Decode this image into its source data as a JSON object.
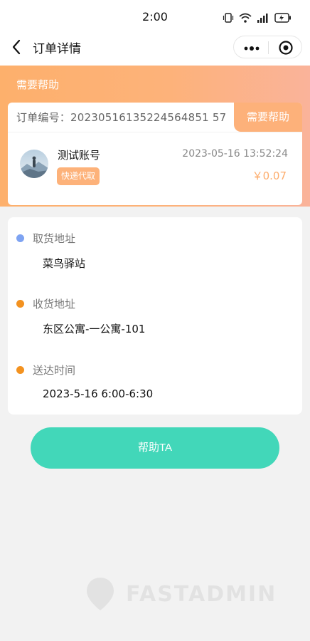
{
  "status_bar": {
    "time": "2:00"
  },
  "nav": {
    "title": "订单详情"
  },
  "header": {
    "title": "需要帮助"
  },
  "order": {
    "order_no_label": "订单编号：",
    "order_no": "20230516135224564851 57",
    "help_tag": "需要帮助",
    "username": "测试账号",
    "service_tag": "快递代取",
    "time": "2023-05-16 13:52:24",
    "price": "￥0.07"
  },
  "details": {
    "pickup_label": "取货地址",
    "pickup_value": "菜鸟驿站",
    "delivery_label": "收货地址",
    "delivery_value": "东区公寓-一公寓-101",
    "time_label": "送达时间",
    "time_value": "2023-5-16 6:00-6:30"
  },
  "actions": {
    "help_button": "帮助TA"
  },
  "watermark": {
    "text": "FASTADMIN"
  },
  "colors": {
    "accent_orange": "#fdb17a",
    "button_teal": "#42d7b9",
    "bullet_blue": "#7ea3f2",
    "bullet_orange": "#f39220"
  }
}
